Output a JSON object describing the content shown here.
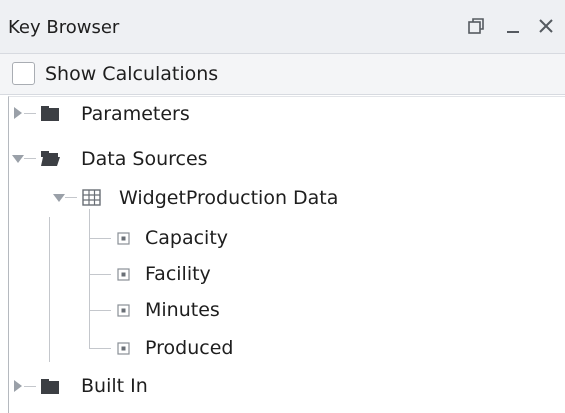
{
  "window": {
    "title": "Key Browser",
    "controls": {
      "float_icon": "float-window-icon",
      "minimize_icon": "minimize-icon",
      "close_icon": "close-icon"
    }
  },
  "options": {
    "show_calculations_label": "Show Calculations",
    "show_calculations_checked": false
  },
  "tree": {
    "parameters": {
      "label": "Parameters",
      "icon": "folder-closed-icon",
      "expanded": false
    },
    "data_sources": {
      "label": "Data Sources",
      "icon": "folder-open-icon",
      "expanded": true,
      "widget_production": {
        "label": "WidgetProduction Data",
        "icon": "table-icon",
        "expanded": true,
        "columns": [
          "Capacity",
          "Facility",
          "Minutes",
          "Produced"
        ]
      }
    },
    "built_in": {
      "label": "Built In",
      "icon": "folder-closed-icon",
      "expanded": false
    }
  },
  "colors": {
    "titlebar_bg": "#eef0f3",
    "options_bg": "#f4f5f7",
    "folder": "#3c3f44",
    "tree_lines": "#c4c7cc"
  }
}
